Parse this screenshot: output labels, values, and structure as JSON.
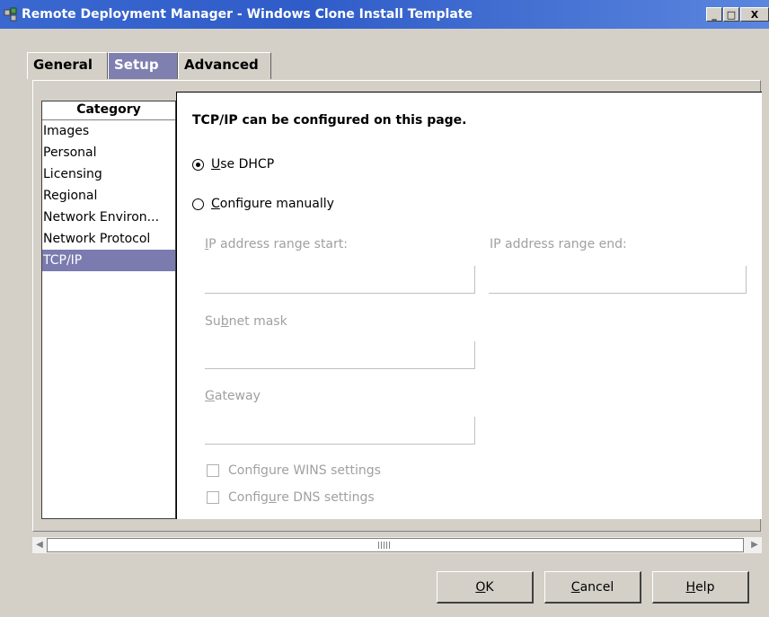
{
  "window": {
    "title": "Remote Deployment Manager - Windows Clone Install Template",
    "controls": [
      "minimize-icon",
      "maximize-icon",
      "close-icon"
    ]
  },
  "tabs": [
    {
      "label": "General",
      "active": false
    },
    {
      "label": "Setup",
      "active": true
    },
    {
      "label": "Advanced",
      "active": false
    }
  ],
  "category": {
    "header": "Category",
    "items": [
      "Images",
      "Personal",
      "Licensing",
      "Regional",
      "Network Environ...",
      "Network Protocol",
      "TCP/IP"
    ],
    "selected": "TCP/IP"
  },
  "tcpip": {
    "heading": "TCP/IP can be configured on this page.",
    "use_dhcp": {
      "label_pre": "",
      "mnemonic": "U",
      "label_post": "se DHCP",
      "selected": true
    },
    "configure_manually": {
      "mnemonic": "C",
      "label_post": "onfigure manually",
      "selected": false
    },
    "ip_start_label": {
      "mnemonic": "I",
      "rest": "P address range start:"
    },
    "ip_start_value": "",
    "ip_end_label": "IP address range end:",
    "ip_end_value": "",
    "subnet_label": {
      "pre": "Su",
      "mnemonic": "b",
      "post": "net mask"
    },
    "subnet_value": "",
    "gateway_label": {
      "mnemonic": "G",
      "rest": "ateway"
    },
    "gateway_value": "",
    "wins": {
      "pre": "Confi",
      "mnemonic": "g",
      "post": "ure WINS settings",
      "checked": false
    },
    "dns": {
      "pre": "Config",
      "mnemonic": "u",
      "post": "re DNS settings",
      "checked": false
    }
  },
  "buttons": {
    "ok": {
      "mnemonic": "O",
      "rest": "K"
    },
    "cancel": {
      "mnemonic": "C",
      "rest": "ancel"
    },
    "help": {
      "mnemonic": "H",
      "rest": "elp"
    }
  },
  "colors": {
    "titlebar": "#3a68d0",
    "selected": "#7b7bb0",
    "disabled_text": "#a0a0a0"
  }
}
